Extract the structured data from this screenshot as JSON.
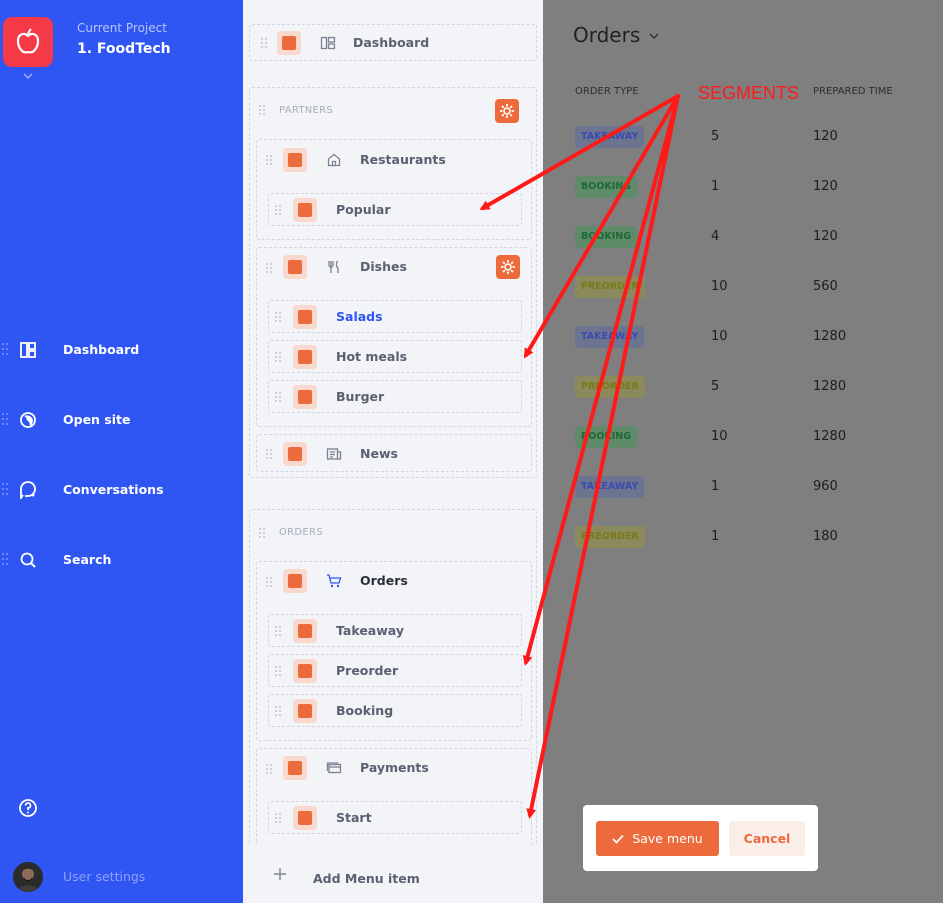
{
  "sidebar": {
    "project_label": "Current Project",
    "project_name": "1. FoodTech",
    "nav": [
      {
        "label": "Dashboard",
        "icon": "dashboard-icon"
      },
      {
        "label": "Open site",
        "icon": "globe-icon"
      },
      {
        "label": "Conversations",
        "icon": "chat-icon"
      },
      {
        "label": "Search",
        "icon": "search-icon"
      }
    ],
    "user_settings": "User settings"
  },
  "editor": {
    "dashboard": "Dashboard",
    "partners_title": "PARTNERS",
    "restaurants": "Restaurants",
    "popular": "Popular",
    "dishes": "Dishes",
    "salads": "Salads",
    "hot_meals": "Hot meals",
    "burger": "Burger",
    "news": "News",
    "orders_title": "ORDERS",
    "orders": "Orders",
    "takeaway": "Takeaway",
    "preorder": "Preorder",
    "booking": "Booking",
    "payments": "Payments",
    "start": "Start",
    "add_item": "Add Menu item"
  },
  "orders_page": {
    "title": "Orders",
    "col_type": "ORDER TYPE",
    "col_prep": "PREPARED TIME",
    "rows": [
      {
        "type": "TAKEAWAY",
        "count": "5",
        "time": "120"
      },
      {
        "type": "BOOKING",
        "count": "1",
        "time": "120"
      },
      {
        "type": "BOOKING",
        "count": "4",
        "time": "120"
      },
      {
        "type": "PREORDER",
        "count": "10",
        "time": "560"
      },
      {
        "type": "TAKEAWAY",
        "count": "10",
        "time": "1280"
      },
      {
        "type": "PREORDER",
        "count": "5",
        "time": "1280"
      },
      {
        "type": "BOOKING",
        "count": "10",
        "time": "1280"
      },
      {
        "type": "TAKEAWAY",
        "count": "1",
        "time": "960"
      },
      {
        "type": "PREORDER",
        "count": "1",
        "time": "180"
      }
    ]
  },
  "dialog": {
    "save": "Save menu",
    "cancel": "Cancel"
  },
  "annotation": {
    "label": "SEGMENTS"
  },
  "colors": {
    "sidebar": "#2f55f2",
    "accent": "#ec6a3c",
    "logo": "#f43a46",
    "annotation": "#ff1a1a"
  }
}
